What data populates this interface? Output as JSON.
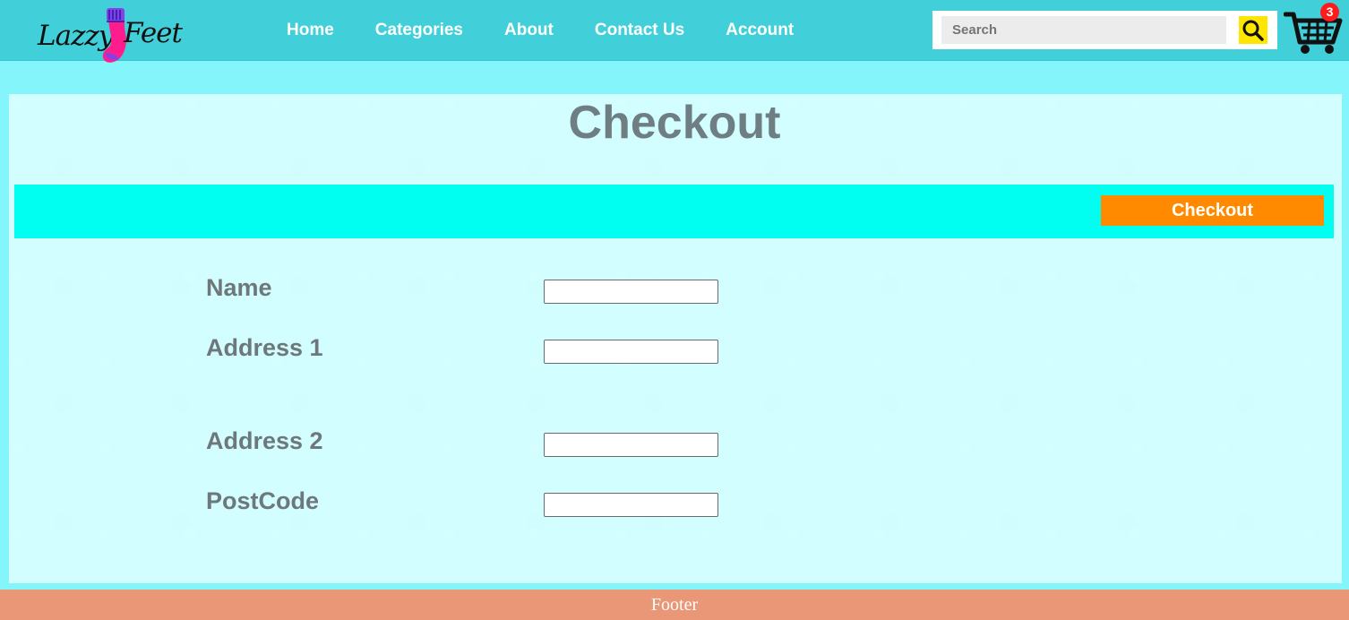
{
  "brand": {
    "logo_text_left": "Lazzy",
    "logo_text_right": "Feet"
  },
  "nav": {
    "items": [
      {
        "label": "Home"
      },
      {
        "label": "Categories"
      },
      {
        "label": "About"
      },
      {
        "label": "Contact Us"
      },
      {
        "label": "Account"
      }
    ]
  },
  "search": {
    "placeholder": "Search",
    "value": "",
    "icon": "search-icon"
  },
  "cart": {
    "icon": "cart-icon",
    "count": "3"
  },
  "page": {
    "title": "Checkout"
  },
  "checkout": {
    "button_label": "Checkout",
    "button_color": "#ff8a00"
  },
  "form": {
    "fields": [
      {
        "label": "Name",
        "value": ""
      },
      {
        "label": "Address 1",
        "value": ""
      },
      {
        "label": "Address 2",
        "value": ""
      },
      {
        "label": "PostCode",
        "value": ""
      }
    ]
  },
  "footer": {
    "text": "Footer"
  },
  "colors": {
    "header": "#41cfd9",
    "page_background": "#7df5fb",
    "band": "#00fff0",
    "footer": "#e99777",
    "search_button": "#ffe600",
    "badge": "#ff1b1b"
  }
}
